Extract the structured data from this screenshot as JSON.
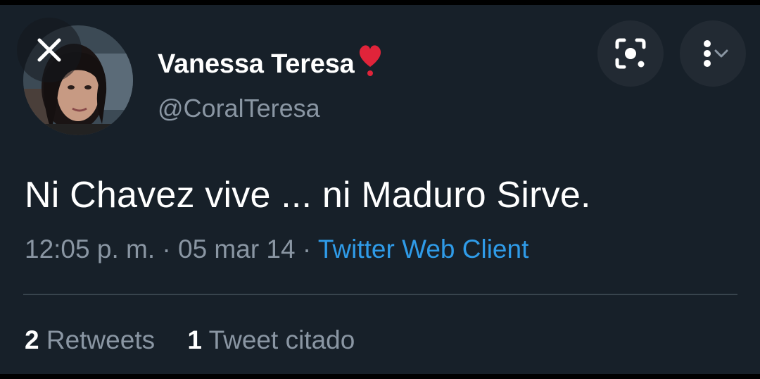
{
  "tweet": {
    "author": {
      "display_name": "Vanessa Teresa",
      "emoji": "heart-exclamation-icon",
      "handle": "@CoralTeresa"
    },
    "text": "Ni Chavez vive ... ni Maduro Sirve.",
    "time": "12:05 p. m.",
    "date": "05 mar 14",
    "separator": "·",
    "source": "Twitter Web Client",
    "stats": {
      "retweets_count": "2",
      "retweets_label": "Retweets",
      "quotes_count": "1",
      "quotes_label": "Tweet citado"
    }
  },
  "overlay": {
    "close_icon": "close-icon",
    "lens_icon": "lens-search-icon",
    "more_icon": "more-vertical-icon"
  },
  "colors": {
    "background": "#172029",
    "text_primary": "#ffffff",
    "text_secondary": "#8a96a3",
    "link": "#2f9be8",
    "divider": "#38444d",
    "heart": "#e0243a"
  }
}
